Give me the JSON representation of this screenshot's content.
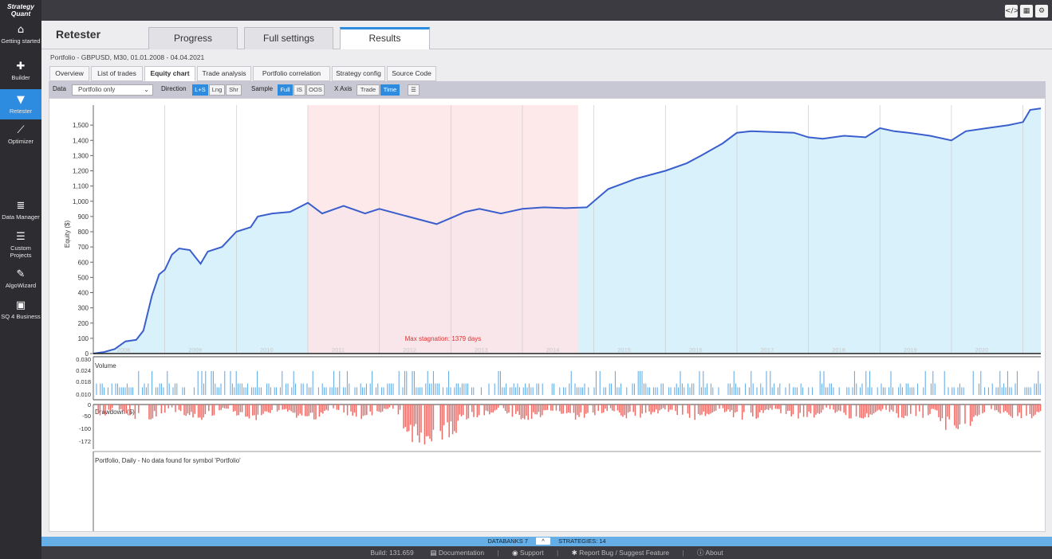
{
  "brand": {
    "line1": "Strategy",
    "line2": "Quant"
  },
  "sidebar": {
    "items": [
      {
        "label": "Getting started",
        "icon": "home-icon",
        "glyph": "⌂"
      },
      {
        "label": "Builder",
        "icon": "plus-icon",
        "glyph": "✚"
      },
      {
        "label": "Retester",
        "icon": "filter-icon",
        "glyph": "▼"
      },
      {
        "label": "Optimizer",
        "icon": "chart-line-icon",
        "glyph": "⟋"
      },
      {
        "label": "Data Manager",
        "icon": "database-icon",
        "glyph": "≣"
      },
      {
        "label": "Custom Projects",
        "icon": "projects-icon",
        "glyph": "☰"
      },
      {
        "label": "AlgoWizard",
        "icon": "wand-icon",
        "glyph": "✎"
      },
      {
        "label": "SQ 4 Business",
        "icon": "briefcase-icon",
        "glyph": "▣"
      }
    ]
  },
  "topbar": {
    "code_icon": "</>",
    "grid_icon": "▦",
    "gear_icon": "⚙"
  },
  "header": {
    "title": "Retester",
    "tabs": [
      "Progress",
      "Full settings",
      "Results"
    ],
    "active_tab": "Results"
  },
  "portfolio_line": "Portfolio - GBPUSD, M30, 01.01.2008 - 04.04.2021",
  "subtabs": [
    "Overview",
    "List of trades",
    "Equity chart",
    "Trade analysis",
    "Portfolio correlation",
    "Strategy config",
    "Source Code"
  ],
  "active_subtab": "Equity chart",
  "toolbar": {
    "data_label": "Data",
    "data_value": "Portfolio only",
    "direction_label": "Direction",
    "direction_options": [
      "L+S",
      "Lng",
      "Shr"
    ],
    "direction_selected": "L+S",
    "sample_label": "Sample",
    "sample_options": [
      "Full",
      "IS",
      "OOS"
    ],
    "sample_selected": "Full",
    "xaxis_label": "X Axis",
    "xaxis_options": [
      "Trade",
      "Time"
    ],
    "xaxis_selected": "Time",
    "menu_icon": "☰"
  },
  "colors": {
    "accent": "#2d8ce0",
    "equity_line": "#3a5fcd",
    "equity_fill": "#d9f1fb",
    "stagnation": "#fde4e6",
    "drawdown": "#f06b66",
    "volume": "#5aa6e6"
  },
  "chart_data": {
    "type": "line",
    "ylabel": "Equity ($)",
    "ylim": [
      0,
      1600
    ],
    "yticks": [
      "1,500",
      "1,400",
      "1,300",
      "1,200",
      "1,100",
      "1,000",
      "900",
      "800",
      "700",
      "600",
      "500",
      "400",
      "300",
      "200",
      "100",
      "0"
    ],
    "years": [
      "2008",
      "2009",
      "2010",
      "2011",
      "2012",
      "2013",
      "2014",
      "2015",
      "2016",
      "2017",
      "2018",
      "2019",
      "2020",
      "2021"
    ],
    "inner_year_labels": [
      "2008",
      "2009",
      "2010",
      "2011",
      "2012",
      "2013",
      "2014",
      "2015",
      "2016",
      "2017",
      "2018",
      "2019",
      "2020",
      "2021"
    ],
    "x": [
      2008.0,
      2008.15,
      2008.3,
      2008.45,
      2008.6,
      2008.7,
      2008.82,
      2008.92,
      2009.0,
      2009.1,
      2009.2,
      2009.35,
      2009.5,
      2009.6,
      2009.8,
      2010.0,
      2010.2,
      2010.3,
      2010.5,
      2010.75,
      2011.0,
      2011.2,
      2011.5,
      2011.8,
      2012.0,
      2012.4,
      2012.8,
      2013.0,
      2013.2,
      2013.4,
      2013.7,
      2014.0,
      2014.3,
      2014.6,
      2014.9,
      2015.0,
      2015.2,
      2015.6,
      2016.0,
      2016.3,
      2016.5,
      2016.8,
      2017.0,
      2017.2,
      2017.5,
      2017.8,
      2018.0,
      2018.2,
      2018.5,
      2018.8,
      2019.0,
      2019.2,
      2019.4,
      2019.7,
      2020.0,
      2020.2,
      2020.5,
      2020.8,
      2021.0,
      2021.1,
      2021.25
    ],
    "values": [
      0,
      10,
      30,
      80,
      90,
      150,
      380,
      520,
      550,
      650,
      690,
      680,
      590,
      670,
      700,
      800,
      830,
      900,
      920,
      930,
      990,
      920,
      970,
      920,
      950,
      900,
      850,
      890,
      930,
      950,
      920,
      950,
      960,
      955,
      960,
      1000,
      1080,
      1150,
      1200,
      1250,
      1300,
      1380,
      1450,
      1460,
      1455,
      1450,
      1420,
      1410,
      1430,
      1420,
      1480,
      1460,
      1450,
      1430,
      1400,
      1460,
      1480,
      1500,
      1520,
      1600,
      1610
    ],
    "stagnation_label": "Max stagnation: 1379 days",
    "stagnation_range": [
      2011.0,
      2014.78
    ],
    "volume_label": "Volume",
    "volume_yticks": [
      "0.030",
      "0.024",
      "0.018",
      "0.010"
    ],
    "drawdown_label": "Drawdown ($)",
    "drawdown_yticks": [
      "0",
      "-50",
      "-100",
      "-172"
    ],
    "drawdown_min": -172,
    "message": "Portfolio, Daily - No data found for symbol 'Portfolio'",
    "legend": [
      "Portfolio"
    ]
  },
  "footer": {
    "databanks": "DATABANKS 7",
    "caret": "^",
    "strategies": "STRATEGIES: 14",
    "build": "Build: 131.659",
    "documentation": "Documentation",
    "support": "Support",
    "report": "Report Bug / Suggest Feature",
    "about": "About",
    "sep": "|"
  }
}
